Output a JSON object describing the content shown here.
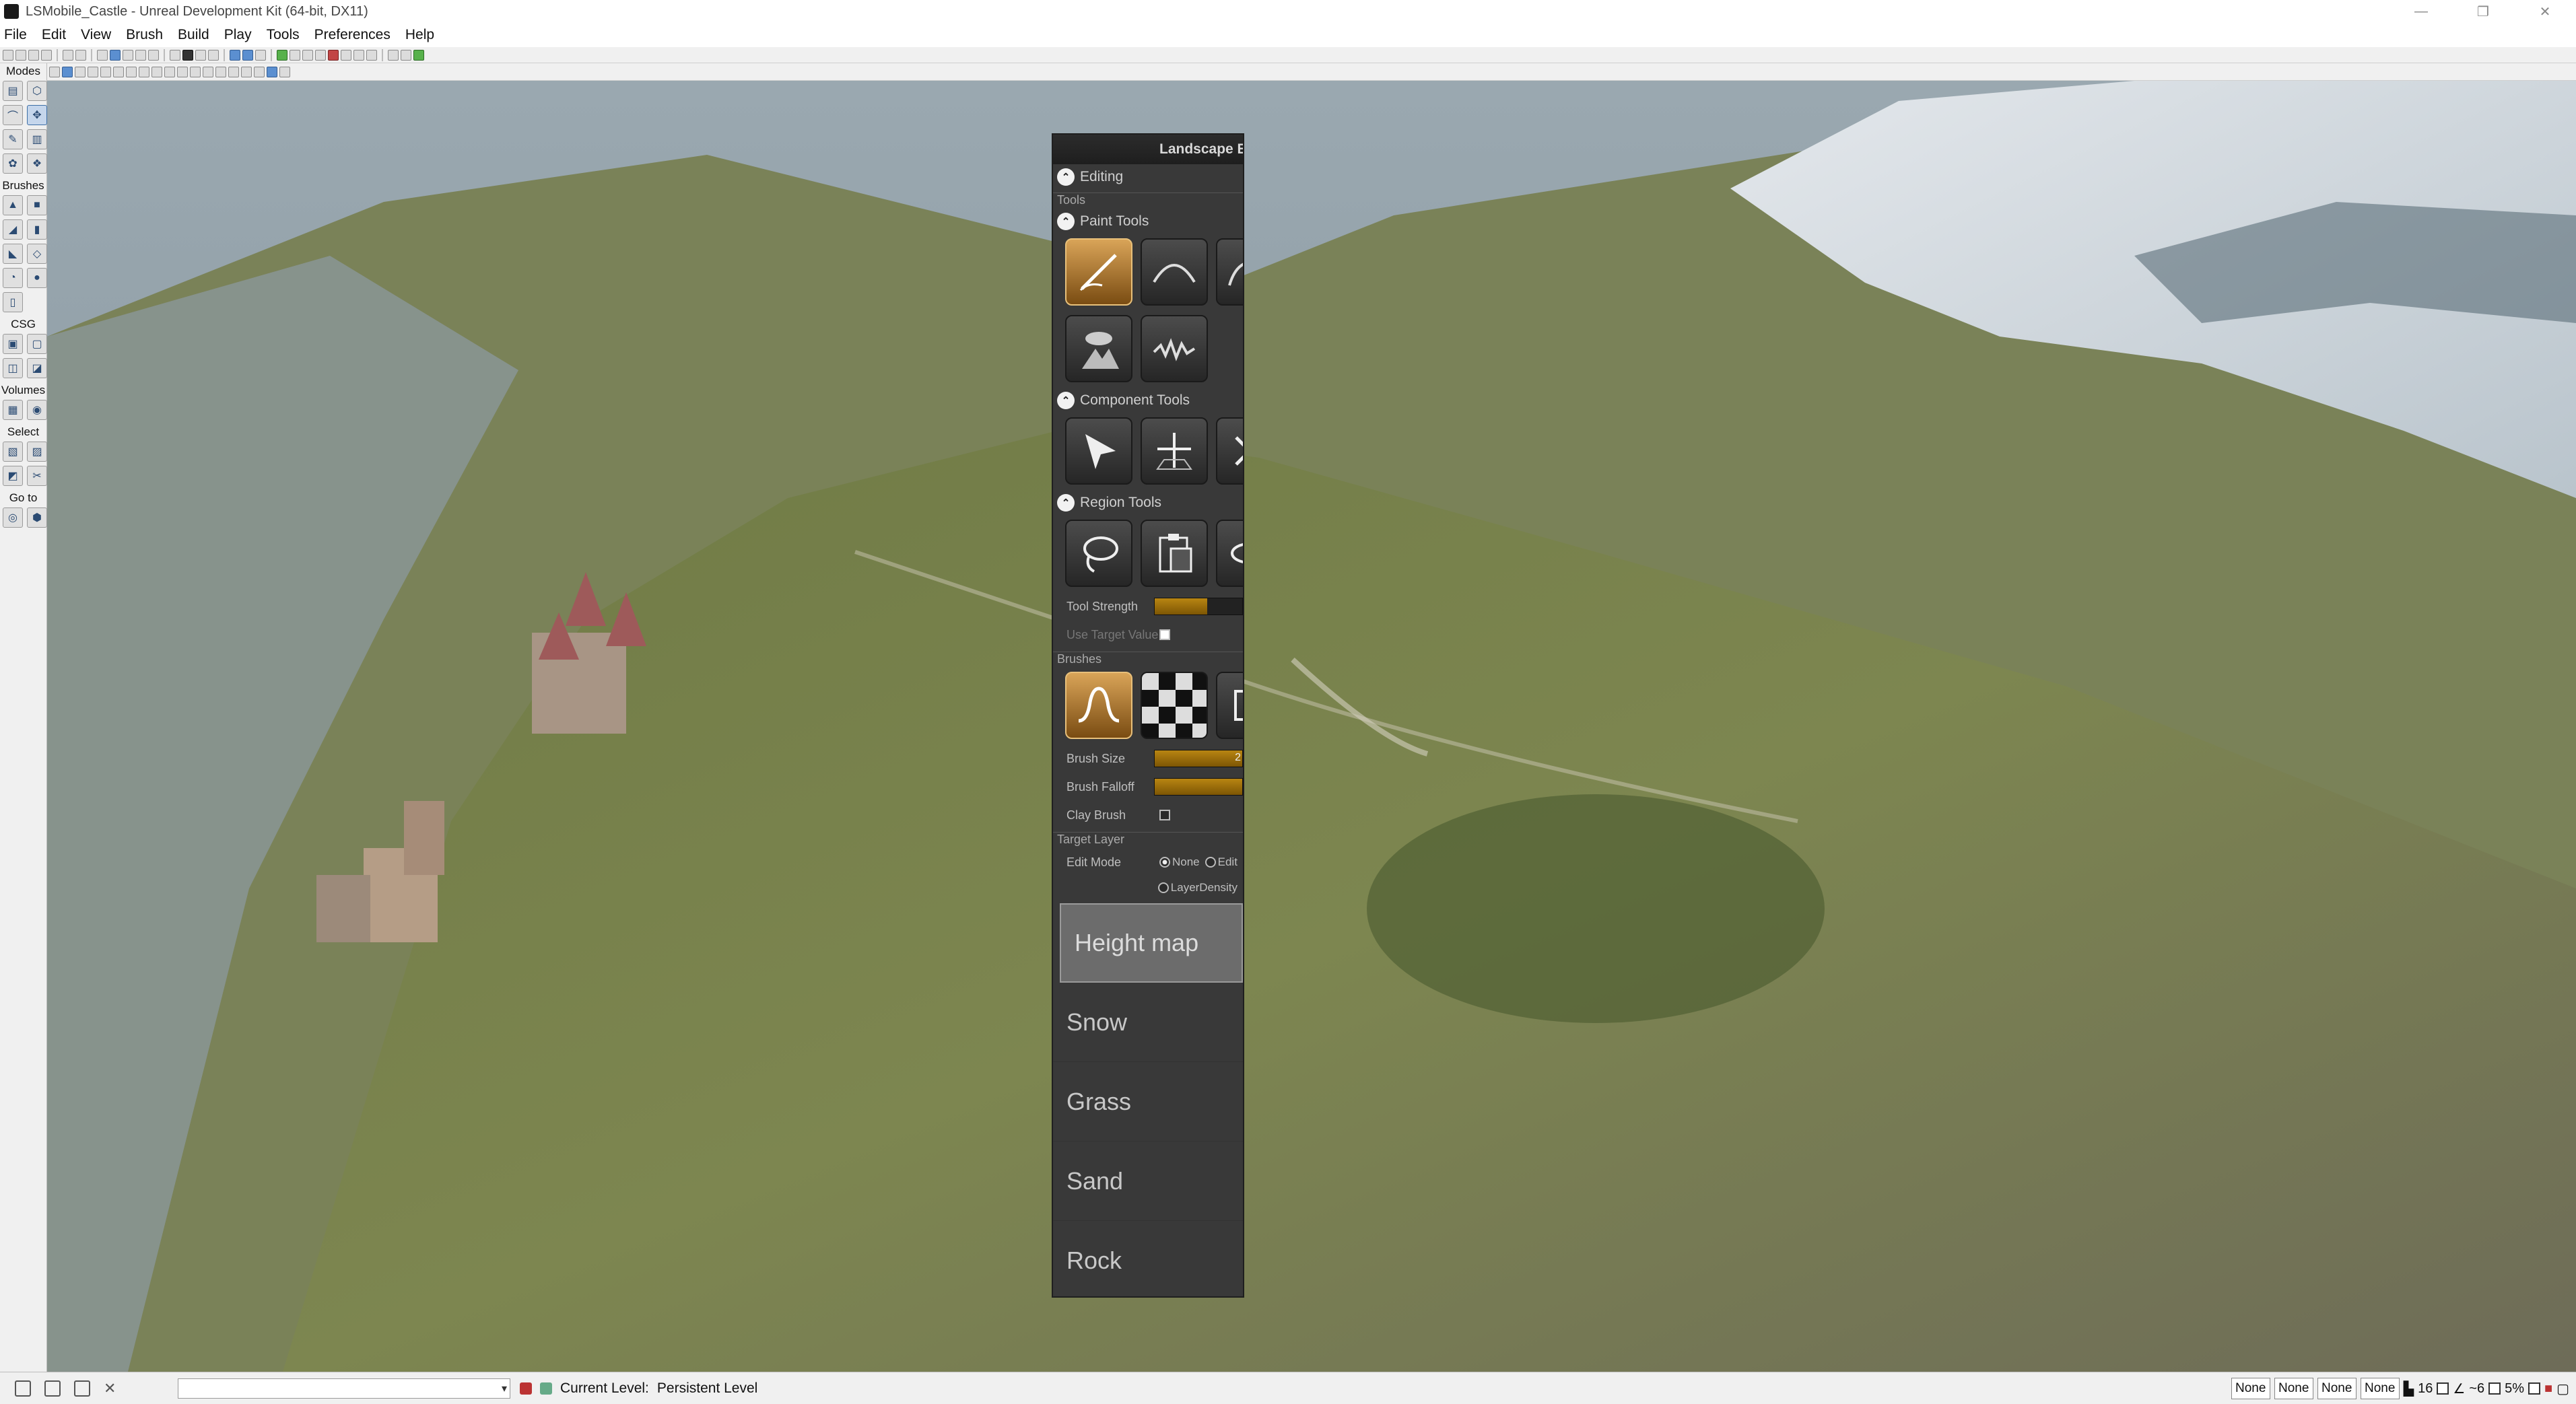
{
  "window": {
    "title": "LSMobile_Castle - Unreal Development Kit (64-bit, DX11)",
    "buttons": [
      "—",
      "❐",
      "✕"
    ]
  },
  "menubar": [
    "File",
    "Edit",
    "View",
    "Brush",
    "Build",
    "Play",
    "Tools",
    "Preferences",
    "Help"
  ],
  "modes": {
    "label": "Modes",
    "sections": [
      "Brushes",
      "CSG",
      "Volumes",
      "Select",
      "Go to"
    ]
  },
  "landscape_panel": {
    "title": "Landscape Ed",
    "editing_label": "Editing",
    "tools_group": "Tools",
    "paint_tools_label": "Paint Tools",
    "component_tools_label": "Component Tools",
    "region_tools_label": "Region Tools",
    "tool_strength": {
      "label": "Tool Strength",
      "fraction": 0.6
    },
    "use_target_value": {
      "label": "Use Target Value",
      "checked": false
    },
    "brushes_group": "Brushes",
    "brush_size": {
      "label": "Brush Size",
      "value": "2",
      "fraction": 1.0
    },
    "brush_falloff": {
      "label": "Brush Falloff",
      "fraction": 1.0
    },
    "clay_brush": {
      "label": "Clay Brush",
      "checked": false
    },
    "target_layer_group": "Target Layer",
    "edit_mode": {
      "label": "Edit Mode",
      "options": [
        "None",
        "Edit",
        "LayerDensity"
      ],
      "selected": "None"
    },
    "layers": [
      "Height map",
      "Snow",
      "Grass",
      "Sand",
      "Rock"
    ],
    "selected_layer": "Height map"
  },
  "status": {
    "current_level_label": "Current Level:",
    "current_level_value": "Persistent Level",
    "none_boxes": [
      "None",
      "None",
      "None",
      "None"
    ],
    "grid_value": "16",
    "angle_value": "~6",
    "scale_value": "5%"
  },
  "colors": {
    "accent_gold": "#b88512",
    "panel_bg": "#393939",
    "selected_tile": "#d9a458"
  }
}
